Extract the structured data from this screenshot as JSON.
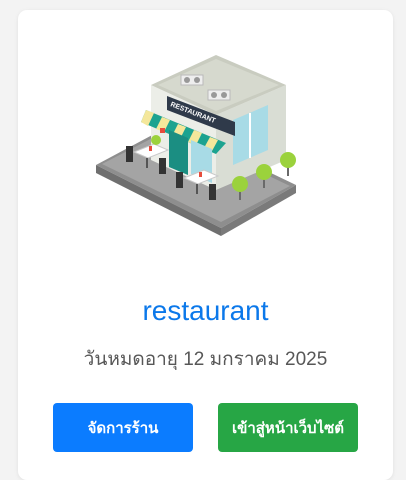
{
  "store": {
    "illustration_icon": "restaurant-building-icon",
    "sign_text": "RESTAURANT",
    "name": "restaurant",
    "expiry": "วันหมดอายุ 12 มกราคม 2025"
  },
  "actions": {
    "manage_label": "จัดการร้าน",
    "visit_label": "เข้าสู่หน้าเว็บไซต์"
  },
  "colors": {
    "name": "#0b78ea",
    "manage_button": "#0b7cff",
    "visit_button": "#27a645"
  }
}
